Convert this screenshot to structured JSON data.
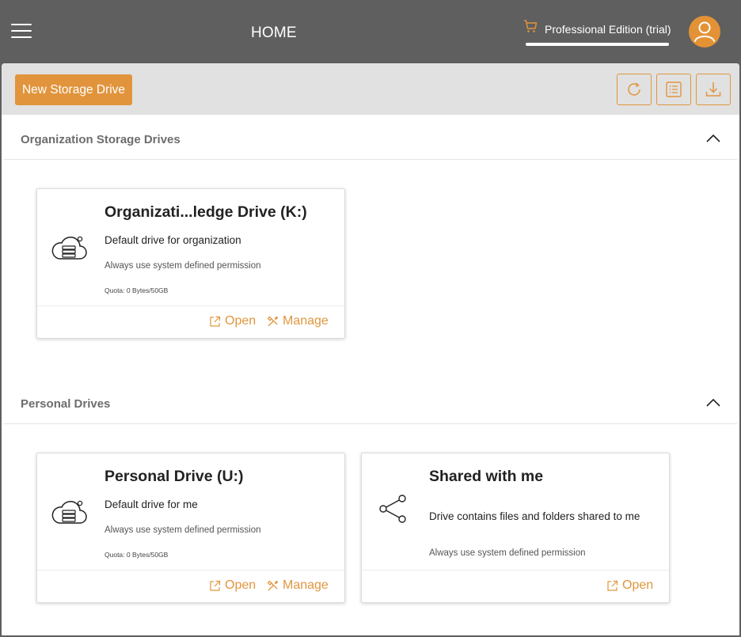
{
  "header": {
    "title": "HOME",
    "edition_label": "Professional Edition (trial)"
  },
  "toolbar": {
    "new_drive_label": "New Storage Drive"
  },
  "sections": [
    {
      "title": "Organization Storage Drives",
      "cards": [
        {
          "title": "Organizati...ledge Drive  (K:)",
          "description": "Default drive for organization",
          "permission": "Always use system defined permission",
          "quota": "Quota: 0 Bytes/50GB",
          "actions": [
            "Open",
            "Manage"
          ]
        }
      ]
    },
    {
      "title": "Personal Drives",
      "cards": [
        {
          "title": "Personal Drive  (U:)",
          "description": "Default drive for me",
          "permission": "Always use system defined permission",
          "quota": "Quota: 0 Bytes/50GB",
          "actions": [
            "Open",
            "Manage"
          ]
        },
        {
          "title": "Shared with me",
          "description": "Drive contains files and folders shared to me",
          "permission": "Always use system defined permission",
          "actions": [
            "Open"
          ]
        }
      ]
    }
  ],
  "colors": {
    "accent": "#e1943c",
    "header_bg": "#5f5f5f",
    "toolbar_bg": "#e1e1e1"
  },
  "icons": {
    "menu": "hamburger-menu-icon",
    "cart": "cart-icon",
    "avatar": "user-icon",
    "refresh": "refresh-icon",
    "list": "list-icon",
    "download": "download-icon",
    "collapse": "chevron-up-icon",
    "cloud_drive": "cloud-drive-icon",
    "share": "share-icon",
    "open": "external-link-icon",
    "manage": "tools-icon"
  }
}
